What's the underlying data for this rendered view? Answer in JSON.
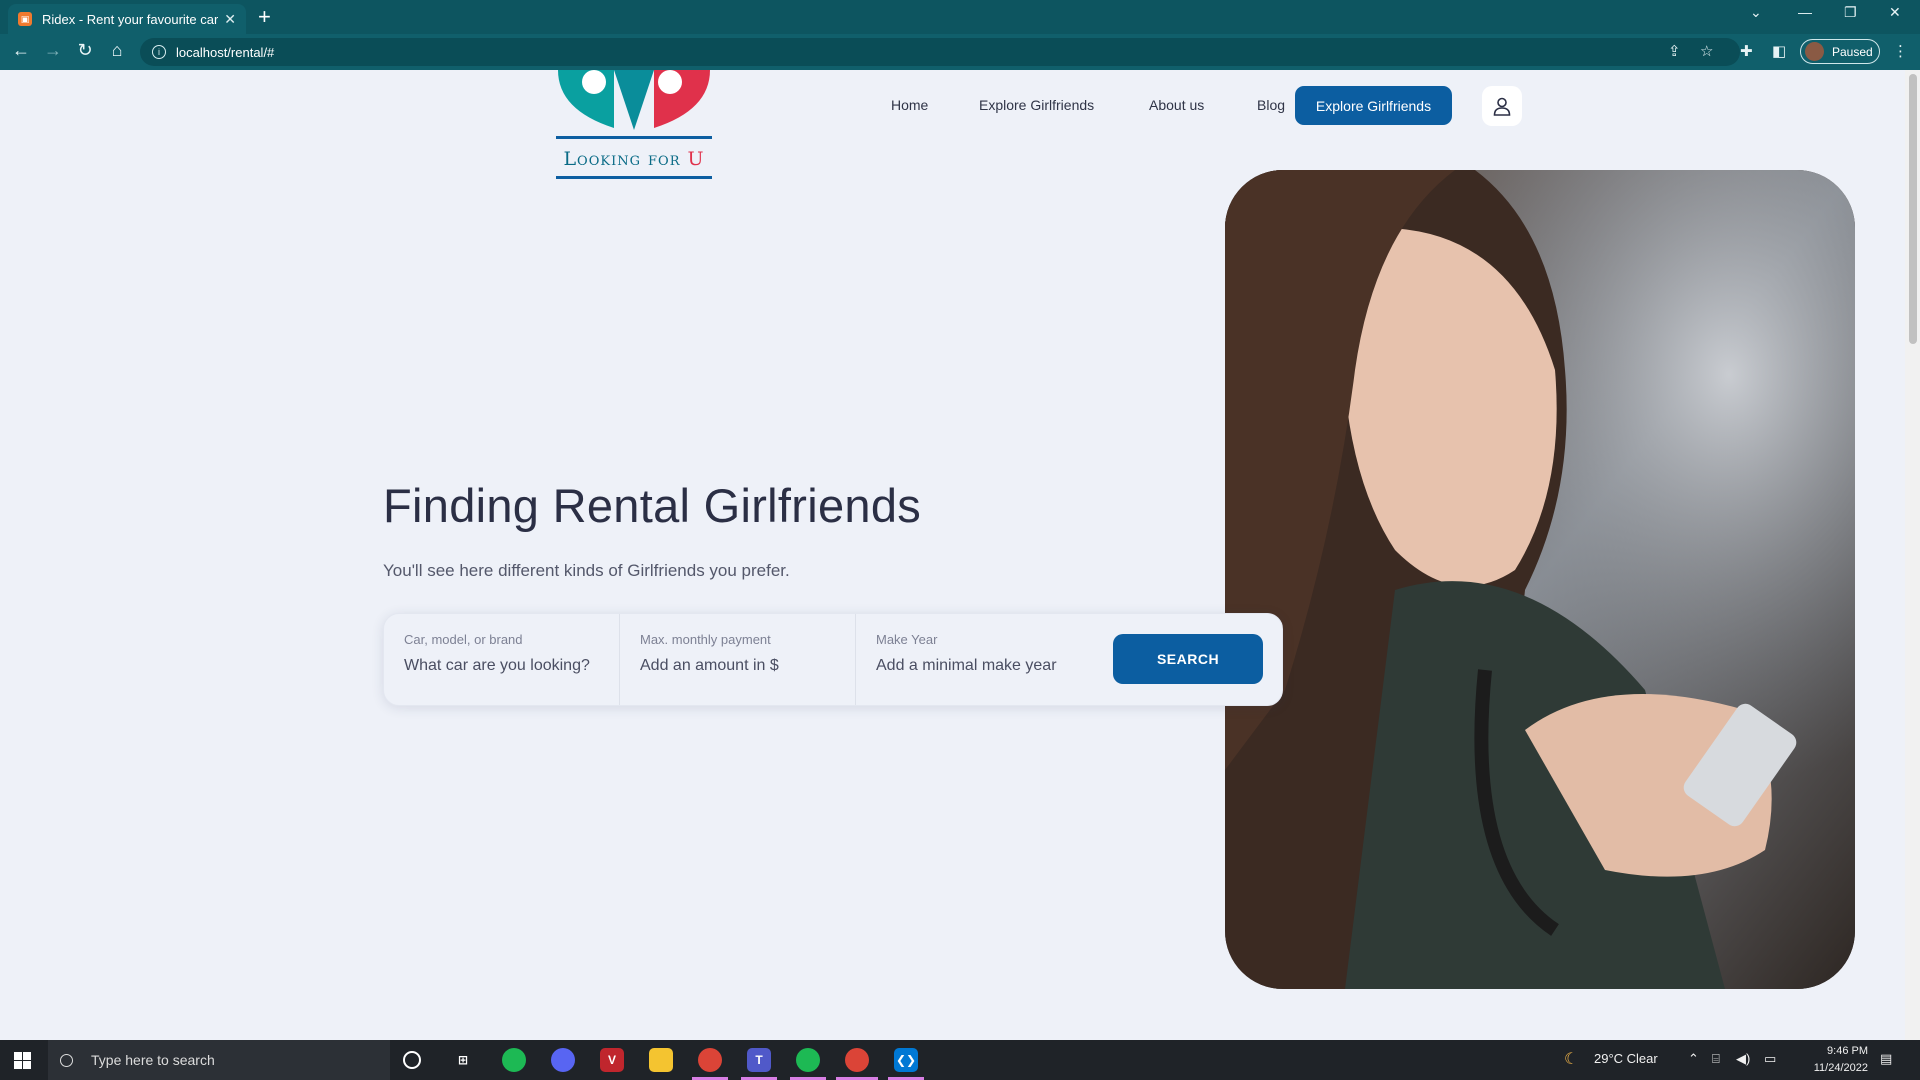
{
  "browser": {
    "tab_title": "Ridex - Rent your favourite car",
    "tab_close": "✕",
    "new_tab": "+",
    "url": "localhost/rental/#",
    "profile_label": "Paused"
  },
  "site": {
    "logo_text_main": "Looking for",
    "logo_text_accent": "U",
    "nav": [
      {
        "label": "Home"
      },
      {
        "label": "Explore Girlfriends"
      },
      {
        "label": "About us"
      },
      {
        "label": "Blog"
      }
    ],
    "nav_cta": "Explore Girlfriends",
    "user_icon": "user-icon"
  },
  "hero": {
    "title": "Finding Rental Girlfriends",
    "subtitle": "You'll see here different kinds of Girlfriends you prefer.",
    "search": {
      "fields": [
        {
          "label": "Car, model, or brand",
          "placeholder": "What car are you looking?"
        },
        {
          "label": "Max. monthly payment",
          "placeholder": "Add an amount in $"
        },
        {
          "label": "Make Year",
          "placeholder": "Add a minimal make year"
        }
      ],
      "button": "SEARCH"
    }
  },
  "taskbar": {
    "search_placeholder": "Type here to search",
    "weather": "29°C  Clear",
    "time": "9:46 PM",
    "date": "11/24/2022"
  },
  "colors": {
    "brand_blue": "#0c5ea1",
    "chrome_teal": "#105f6b",
    "logo_teal": "#0aa0a0",
    "logo_red": "#e0314b"
  }
}
